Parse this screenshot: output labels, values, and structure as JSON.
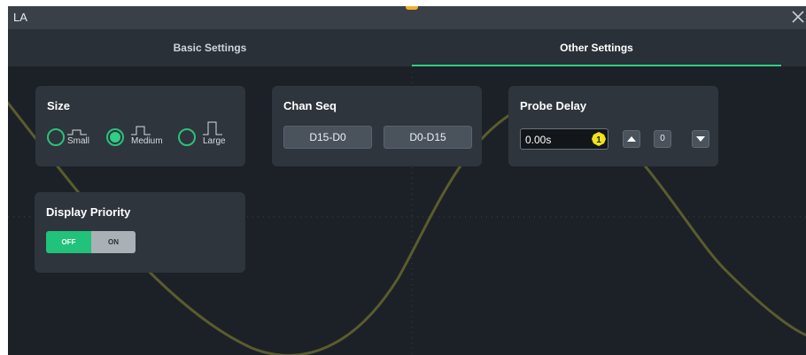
{
  "window": {
    "title": "LA"
  },
  "tabs": [
    {
      "label": "Basic Settings",
      "active": false
    },
    {
      "label": "Other Settings",
      "active": true
    }
  ],
  "size": {
    "title": "Size",
    "options": [
      {
        "label": "Small",
        "checked": false
      },
      {
        "label": "Medium",
        "checked": true
      },
      {
        "label": "Large",
        "checked": false
      }
    ]
  },
  "chan_seq": {
    "title": "Chan Seq",
    "buttons": [
      "D15-D0",
      "D0-D15"
    ]
  },
  "probe_delay": {
    "title": "Probe Delay",
    "value": "0.00s",
    "step": "0"
  },
  "display_priority": {
    "title": "Display Priority",
    "off_label": "OFF",
    "on_label": "ON",
    "state": "OFF"
  },
  "colors": {
    "accent": "#2ecf86",
    "knob": "#f2e21a",
    "trace": "#595c2e",
    "background": "#1c2127"
  }
}
